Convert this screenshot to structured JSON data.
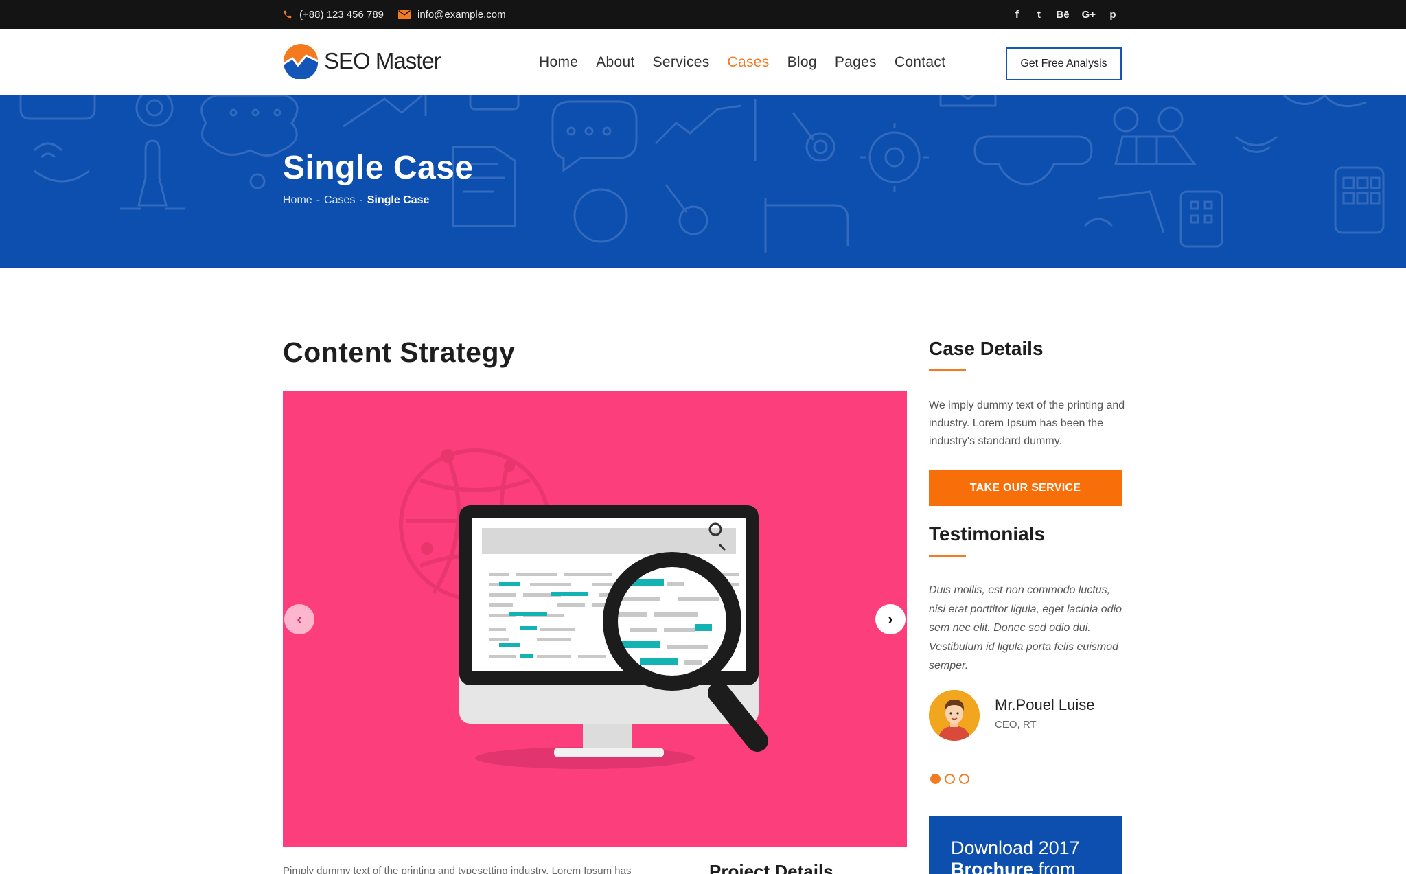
{
  "topbar": {
    "phone": "(+88) 123 456 789",
    "email": "info@example.com",
    "socials": [
      {
        "icon": "facebook-icon",
        "glyph": "f"
      },
      {
        "icon": "twitter-icon",
        "glyph": "t"
      },
      {
        "icon": "behance-icon",
        "glyph": "Bē"
      },
      {
        "icon": "google-plus-icon",
        "glyph": "G+"
      },
      {
        "icon": "pinterest-icon",
        "glyph": "p"
      }
    ]
  },
  "header": {
    "logo_text": "SEO Master",
    "nav": [
      "Home",
      "About",
      "Services",
      "Cases",
      "Blog",
      "Pages",
      "Contact"
    ],
    "active_nav": "Cases",
    "cta_label": "Get Free Analysis"
  },
  "hero": {
    "title": "Single Case",
    "breadcrumb": [
      "Home",
      "Cases",
      "Single Case"
    ]
  },
  "main": {
    "title": "Content Strategy",
    "body_text": "Pimply dummy text of the printing and typesetting industry. Lorem Ipsum has",
    "project_details_heading": "Project Details"
  },
  "sidebar": {
    "case_details_heading": "Case Details",
    "case_details_text": "We imply dummy text of the printing and industry. Lorem Ipsum has been the industry's standard dummy.",
    "take_service_label": "TAKE OUR SERVICE",
    "testimonials_heading": "Testimonials",
    "testimonial_text": "Duis mollis, est non commodo luctus, nisi erat porttitor ligula, eget lacinia odio sem nec elit. Donec sed odio dui. Vestibulum id ligula porta felis euismod semper.",
    "author_name": "Mr.Pouel Luise",
    "author_role": "CEO, RT",
    "download_line1": "Download 2017",
    "download_line2_bold": "Brochure",
    "download_line2_rest": " from"
  },
  "colors": {
    "accent": "#f47a20",
    "brand_blue": "#0d4fae",
    "slide_pink": "#fc3f7c",
    "topbar": "#141414"
  }
}
